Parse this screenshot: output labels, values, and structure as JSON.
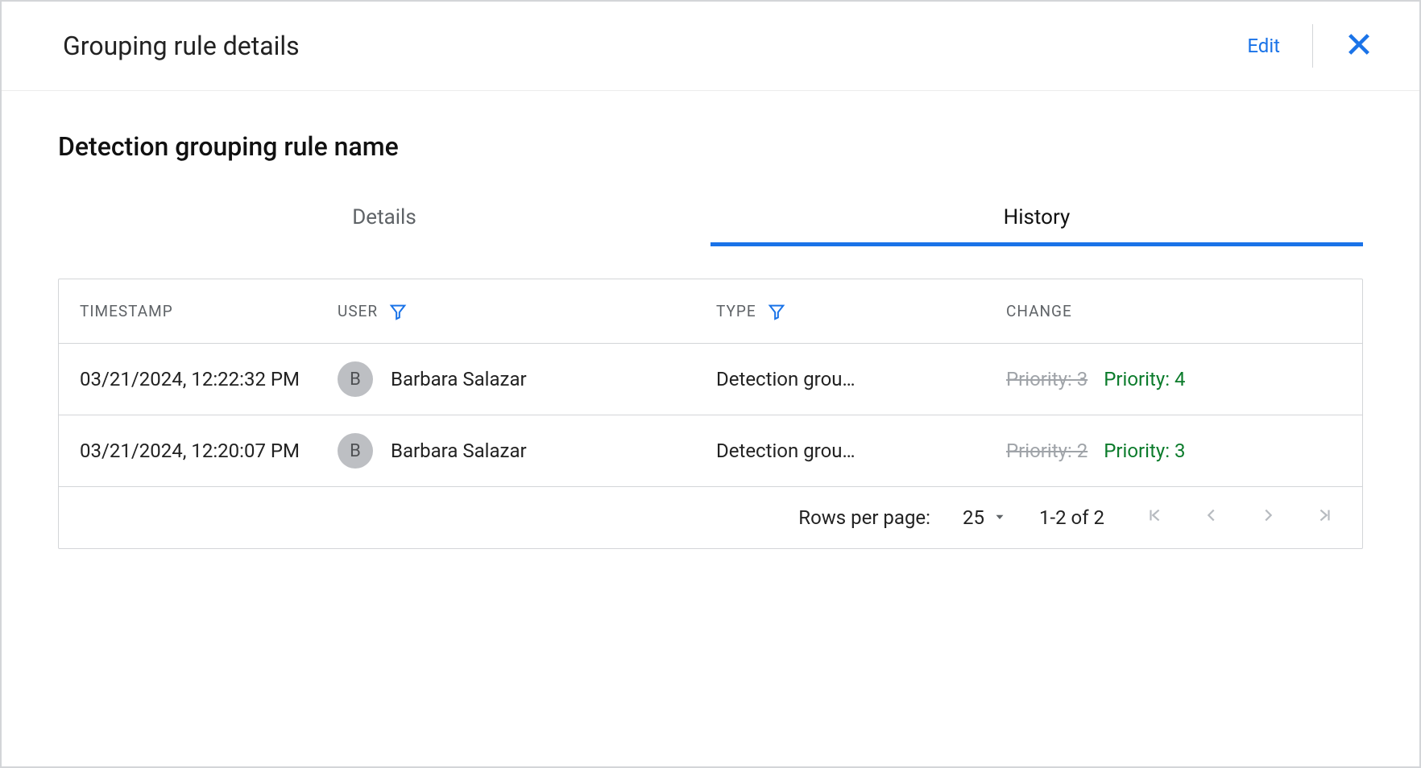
{
  "header": {
    "title": "Grouping rule details",
    "edit_label": "Edit"
  },
  "main": {
    "heading": "Detection grouping rule name",
    "tabs": [
      {
        "label": "Details",
        "active": false
      },
      {
        "label": "History",
        "active": true
      }
    ]
  },
  "table": {
    "columns": {
      "timestamp": "TIMESTAMP",
      "user": "USER",
      "type": "TYPE",
      "change": "CHANGE"
    },
    "rows": [
      {
        "timestamp": "03/21/2024, 12:22:32 PM",
        "user_initial": "B",
        "user_name": "Barbara Salazar",
        "type": "Detection grou…",
        "change_old": "Priority: 3",
        "change_new": "Priority: 4"
      },
      {
        "timestamp": "03/21/2024, 12:20:07 PM",
        "user_initial": "B",
        "user_name": "Barbara Salazar",
        "type": "Detection grou…",
        "change_old": "Priority: 2",
        "change_new": "Priority: 3"
      }
    ]
  },
  "pagination": {
    "rows_per_page_label": "Rows per page:",
    "rows_per_page_value": "25",
    "range_text": "1-2 of 2"
  }
}
